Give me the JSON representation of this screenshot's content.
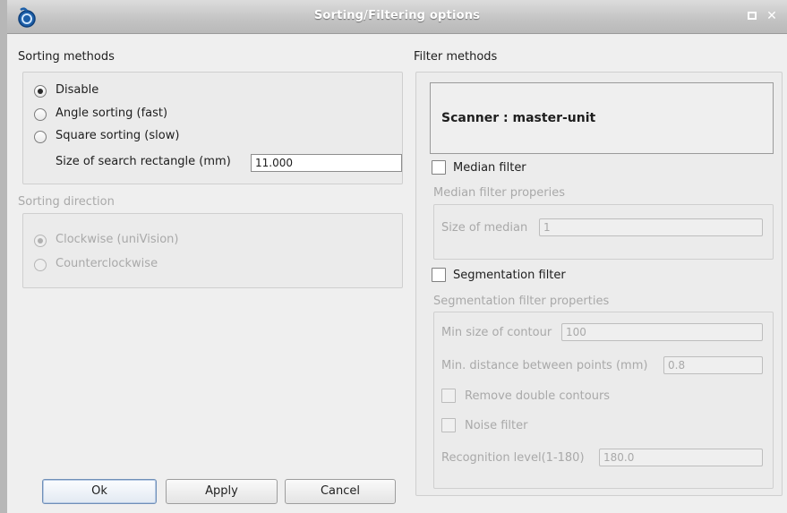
{
  "window": {
    "title": "Sorting/Filtering options"
  },
  "sorting": {
    "header": "Sorting methods",
    "options": [
      "Disable",
      "Angle sorting (fast)",
      "Square sorting (slow)"
    ],
    "selected": "Disable",
    "search_rect_label": "Size of search rectangle (mm)",
    "search_rect_value": "11.000"
  },
  "direction": {
    "header": "Sorting direction",
    "options": [
      "Clockwise  (uniVision)",
      "Counterclockwise"
    ],
    "selected": "Clockwise  (uniVision)"
  },
  "filter": {
    "header": "Filter methods",
    "scanner_label": "Scanner :  master-unit",
    "median": {
      "checkbox_label": "Median filter",
      "group_header": "Median filter properies",
      "size_label": "Size of median",
      "size_value": "1"
    },
    "segmentation": {
      "checkbox_label": "Segmentation filter",
      "group_header": "Segmentation filter properties",
      "min_contour_label": "Min size of contour",
      "min_contour_value": "100",
      "min_distance_label": "Min. distance between points (mm)",
      "min_distance_value": "0.8",
      "remove_double_label": "Remove double contours",
      "noise_label": "Noise filter",
      "recognition_label": "Recognition level(1-180)",
      "recognition_value": "180.0"
    }
  },
  "buttons": {
    "ok": "Ok",
    "apply": "Apply",
    "cancel": "Cancel"
  },
  "colors": {
    "titlebar": "#c3c3c3",
    "background": "#efefef",
    "disabled_text": "#a9a9a9"
  }
}
